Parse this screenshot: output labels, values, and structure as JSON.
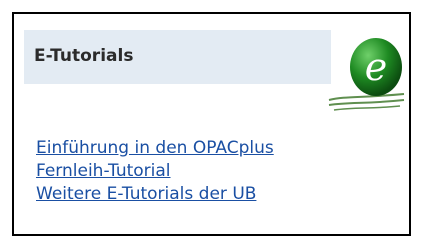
{
  "panel": {
    "title": "E-Tutorials",
    "logo": {
      "icon": "e-learning-logo-icon",
      "letter": "e",
      "colors": {
        "ball": "#1e8a22",
        "letter": "#ffffff",
        "lines": "#5f8f4f"
      }
    },
    "links": [
      {
        "label": "Einführung in den OPACplus"
      },
      {
        "label": "Fernleih-Tutorial"
      },
      {
        "label": "Weitere E-Tutorials der UB"
      }
    ]
  },
  "colors": {
    "header_band": "#e3ebf3",
    "link": "#1a4fa3",
    "border": "#000000"
  }
}
